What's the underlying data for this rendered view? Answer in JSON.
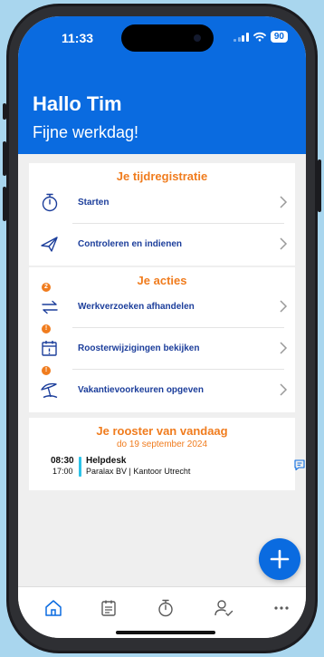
{
  "status": {
    "time": "11:33",
    "battery": "90"
  },
  "header": {
    "greeting": "Hallo Tim",
    "subtitle": "Fijne werkdag!"
  },
  "time_registration": {
    "title": "Je tijdregistratie",
    "items": [
      {
        "label": "Starten",
        "icon": "stopwatch-icon"
      },
      {
        "label": "Controleren en indienen",
        "icon": "send-icon"
      }
    ]
  },
  "actions": {
    "title": "Je acties",
    "items": [
      {
        "label": "Werkverzoeken afhandelen",
        "icon": "swap-arrows-icon",
        "badge": "2"
      },
      {
        "label": "Roosterwijzigingen bekijken",
        "icon": "calendar-alert-icon",
        "badge": "!"
      },
      {
        "label": "Vakantievoorkeuren opgeven",
        "icon": "beach-umbrella-icon",
        "badge": "!"
      }
    ]
  },
  "roster": {
    "title": "Je rooster van vandaag",
    "date": "do 19 september 2024",
    "appointment": {
      "start": "08:30",
      "end": "17:00",
      "title": "Helpdesk",
      "location": "Paralax BV | Kantoor Utrecht",
      "color": "#2cc3e8"
    }
  },
  "tabbar": [
    "home-icon",
    "schedule-icon",
    "stopwatch-icon",
    "user-check-icon",
    "more-icon"
  ],
  "colors": {
    "primary": "#0a6be0",
    "accent": "#f07c1e",
    "label": "#1c3e9b"
  }
}
